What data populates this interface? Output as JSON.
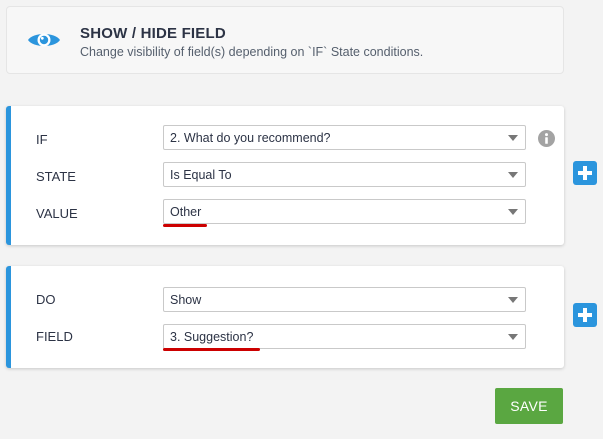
{
  "header": {
    "title": "SHOW / HIDE FIELD",
    "subtitle": "Change visibility of field(s) depending on `IF` State conditions.",
    "icon": "eye-icon",
    "icon_color": "#2b95dd"
  },
  "condition": {
    "rows": [
      {
        "label": "IF",
        "value": "2. What do you recommend?"
      },
      {
        "label": "STATE",
        "value": "Is Equal To"
      },
      {
        "label": "VALUE",
        "value": "Other"
      }
    ],
    "info_icon": "info-icon"
  },
  "action": {
    "rows": [
      {
        "label": "DO",
        "value": "Show"
      },
      {
        "label": "FIELD",
        "value": "3. Suggestion?"
      }
    ]
  },
  "buttons": {
    "add_condition_icon": "plus-icon",
    "add_action_icon": "plus-icon",
    "save_label": "SAVE"
  },
  "colors": {
    "accent": "#2b95dd",
    "save": "#5aa741",
    "annotation_underline": "#cc0000"
  }
}
